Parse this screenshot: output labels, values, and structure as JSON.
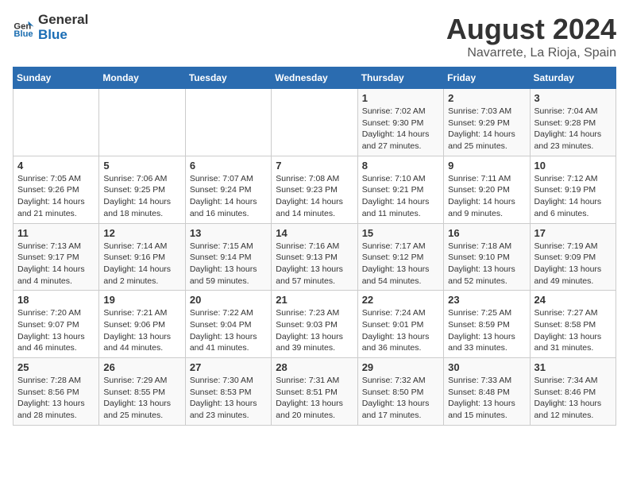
{
  "header": {
    "logo_general": "General",
    "logo_blue": "Blue",
    "title": "August 2024",
    "subtitle": "Navarrete, La Rioja, Spain"
  },
  "calendar": {
    "days_of_week": [
      "Sunday",
      "Monday",
      "Tuesday",
      "Wednesday",
      "Thursday",
      "Friday",
      "Saturday"
    ],
    "weeks": [
      [
        {
          "date": "",
          "info": ""
        },
        {
          "date": "",
          "info": ""
        },
        {
          "date": "",
          "info": ""
        },
        {
          "date": "",
          "info": ""
        },
        {
          "date": "1",
          "info": "Sunrise: 7:02 AM\nSunset: 9:30 PM\nDaylight: 14 hours and 27 minutes."
        },
        {
          "date": "2",
          "info": "Sunrise: 7:03 AM\nSunset: 9:29 PM\nDaylight: 14 hours and 25 minutes."
        },
        {
          "date": "3",
          "info": "Sunrise: 7:04 AM\nSunset: 9:28 PM\nDaylight: 14 hours and 23 minutes."
        }
      ],
      [
        {
          "date": "4",
          "info": "Sunrise: 7:05 AM\nSunset: 9:26 PM\nDaylight: 14 hours and 21 minutes."
        },
        {
          "date": "5",
          "info": "Sunrise: 7:06 AM\nSunset: 9:25 PM\nDaylight: 14 hours and 18 minutes."
        },
        {
          "date": "6",
          "info": "Sunrise: 7:07 AM\nSunset: 9:24 PM\nDaylight: 14 hours and 16 minutes."
        },
        {
          "date": "7",
          "info": "Sunrise: 7:08 AM\nSunset: 9:23 PM\nDaylight: 14 hours and 14 minutes."
        },
        {
          "date": "8",
          "info": "Sunrise: 7:10 AM\nSunset: 9:21 PM\nDaylight: 14 hours and 11 minutes."
        },
        {
          "date": "9",
          "info": "Sunrise: 7:11 AM\nSunset: 9:20 PM\nDaylight: 14 hours and 9 minutes."
        },
        {
          "date": "10",
          "info": "Sunrise: 7:12 AM\nSunset: 9:19 PM\nDaylight: 14 hours and 6 minutes."
        }
      ],
      [
        {
          "date": "11",
          "info": "Sunrise: 7:13 AM\nSunset: 9:17 PM\nDaylight: 14 hours and 4 minutes."
        },
        {
          "date": "12",
          "info": "Sunrise: 7:14 AM\nSunset: 9:16 PM\nDaylight: 14 hours and 2 minutes."
        },
        {
          "date": "13",
          "info": "Sunrise: 7:15 AM\nSunset: 9:14 PM\nDaylight: 13 hours and 59 minutes."
        },
        {
          "date": "14",
          "info": "Sunrise: 7:16 AM\nSunset: 9:13 PM\nDaylight: 13 hours and 57 minutes."
        },
        {
          "date": "15",
          "info": "Sunrise: 7:17 AM\nSunset: 9:12 PM\nDaylight: 13 hours and 54 minutes."
        },
        {
          "date": "16",
          "info": "Sunrise: 7:18 AM\nSunset: 9:10 PM\nDaylight: 13 hours and 52 minutes."
        },
        {
          "date": "17",
          "info": "Sunrise: 7:19 AM\nSunset: 9:09 PM\nDaylight: 13 hours and 49 minutes."
        }
      ],
      [
        {
          "date": "18",
          "info": "Sunrise: 7:20 AM\nSunset: 9:07 PM\nDaylight: 13 hours and 46 minutes."
        },
        {
          "date": "19",
          "info": "Sunrise: 7:21 AM\nSunset: 9:06 PM\nDaylight: 13 hours and 44 minutes."
        },
        {
          "date": "20",
          "info": "Sunrise: 7:22 AM\nSunset: 9:04 PM\nDaylight: 13 hours and 41 minutes."
        },
        {
          "date": "21",
          "info": "Sunrise: 7:23 AM\nSunset: 9:03 PM\nDaylight: 13 hours and 39 minutes."
        },
        {
          "date": "22",
          "info": "Sunrise: 7:24 AM\nSunset: 9:01 PM\nDaylight: 13 hours and 36 minutes."
        },
        {
          "date": "23",
          "info": "Sunrise: 7:25 AM\nSunset: 8:59 PM\nDaylight: 13 hours and 33 minutes."
        },
        {
          "date": "24",
          "info": "Sunrise: 7:27 AM\nSunset: 8:58 PM\nDaylight: 13 hours and 31 minutes."
        }
      ],
      [
        {
          "date": "25",
          "info": "Sunrise: 7:28 AM\nSunset: 8:56 PM\nDaylight: 13 hours and 28 minutes."
        },
        {
          "date": "26",
          "info": "Sunrise: 7:29 AM\nSunset: 8:55 PM\nDaylight: 13 hours and 25 minutes."
        },
        {
          "date": "27",
          "info": "Sunrise: 7:30 AM\nSunset: 8:53 PM\nDaylight: 13 hours and 23 minutes."
        },
        {
          "date": "28",
          "info": "Sunrise: 7:31 AM\nSunset: 8:51 PM\nDaylight: 13 hours and 20 minutes."
        },
        {
          "date": "29",
          "info": "Sunrise: 7:32 AM\nSunset: 8:50 PM\nDaylight: 13 hours and 17 minutes."
        },
        {
          "date": "30",
          "info": "Sunrise: 7:33 AM\nSunset: 8:48 PM\nDaylight: 13 hours and 15 minutes."
        },
        {
          "date": "31",
          "info": "Sunrise: 7:34 AM\nSunset: 8:46 PM\nDaylight: 13 hours and 12 minutes."
        }
      ]
    ]
  }
}
